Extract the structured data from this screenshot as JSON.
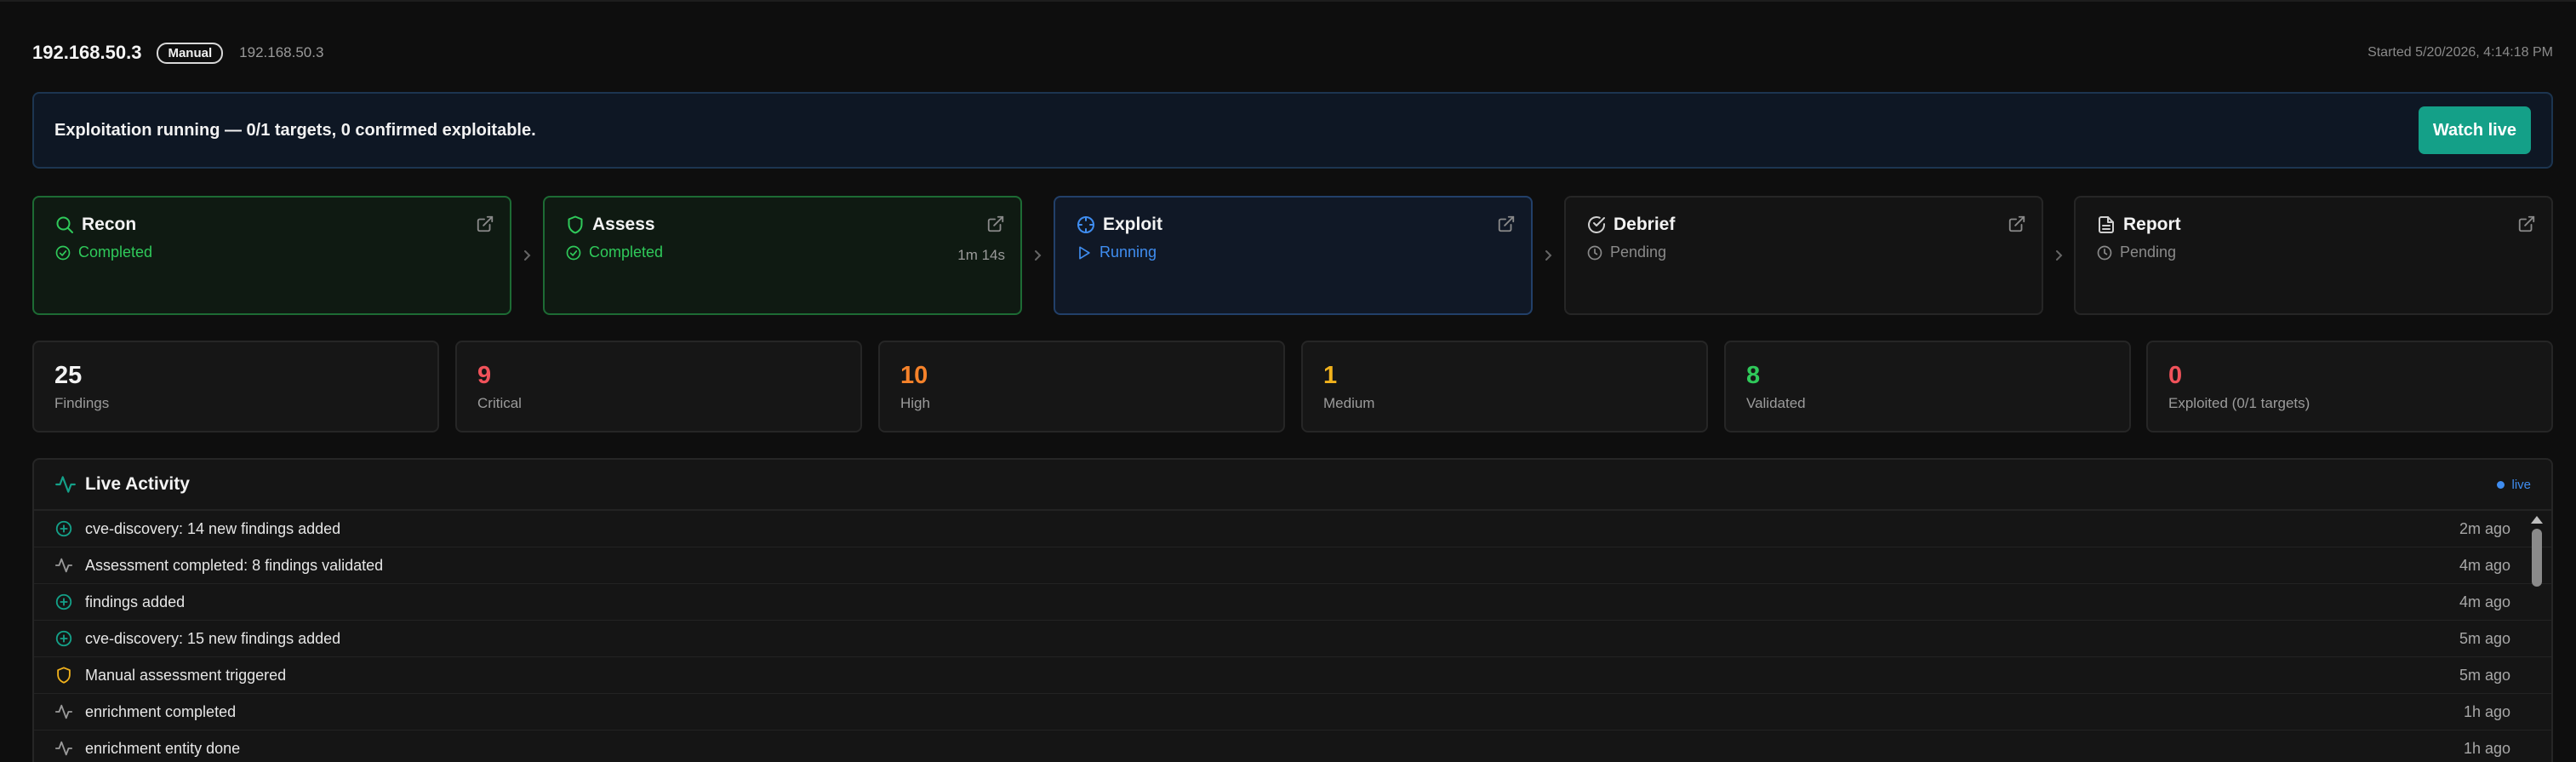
{
  "header": {
    "title": "192.168.50.3",
    "badge": "Manual",
    "subtitle": "192.168.50.3",
    "started": "Started 5/20/2026, 4:14:18 PM"
  },
  "banner": {
    "text": "Exploitation running — 0/1 targets, 0 confirmed exploitable.",
    "button_label": "Watch live"
  },
  "stages": [
    {
      "name": "Recon",
      "status": "Completed",
      "duration": ""
    },
    {
      "name": "Assess",
      "status": "Completed",
      "duration": "1m 14s"
    },
    {
      "name": "Exploit",
      "status": "Running",
      "duration": ""
    },
    {
      "name": "Debrief",
      "status": "Pending",
      "duration": ""
    },
    {
      "name": "Report",
      "status": "Pending",
      "duration": ""
    }
  ],
  "stats": [
    {
      "value": "25",
      "label": "Findings",
      "color": "#f2f2f2"
    },
    {
      "value": "9",
      "label": "Critical",
      "color": "#f0525a"
    },
    {
      "value": "10",
      "label": "High",
      "color": "#f5822a"
    },
    {
      "value": "1",
      "label": "Medium",
      "color": "#f2b21c"
    },
    {
      "value": "8",
      "label": "Validated",
      "color": "#2fc95a"
    },
    {
      "value": "0",
      "label": "Exploited (0/1 targets)",
      "color": "#f0525a"
    }
  ],
  "activity": {
    "title": "Live Activity",
    "live_label": "live",
    "items": [
      {
        "text": "cve-discovery: 14 new findings added",
        "time": "2m ago",
        "icon": "plus-circle-icon"
      },
      {
        "text": "Assessment completed: 8 findings validated",
        "time": "4m ago",
        "icon": "activity-icon"
      },
      {
        "text": "findings added",
        "time": "4m ago",
        "icon": "plus-circle-icon"
      },
      {
        "text": "cve-discovery: 15 new findings added",
        "time": "5m ago",
        "icon": "plus-circle-icon"
      },
      {
        "text": "Manual assessment triggered",
        "time": "5m ago",
        "icon": "shield-icon"
      },
      {
        "text": "enrichment completed",
        "time": "1h ago",
        "icon": "activity-icon"
      },
      {
        "text": "enrichment entity done",
        "time": "1h ago",
        "icon": "activity-icon"
      }
    ]
  },
  "colors": {
    "accent": "#14a088",
    "completed": "#2fc95a",
    "running": "#3f8df0",
    "pending": "#8a8a8a"
  }
}
